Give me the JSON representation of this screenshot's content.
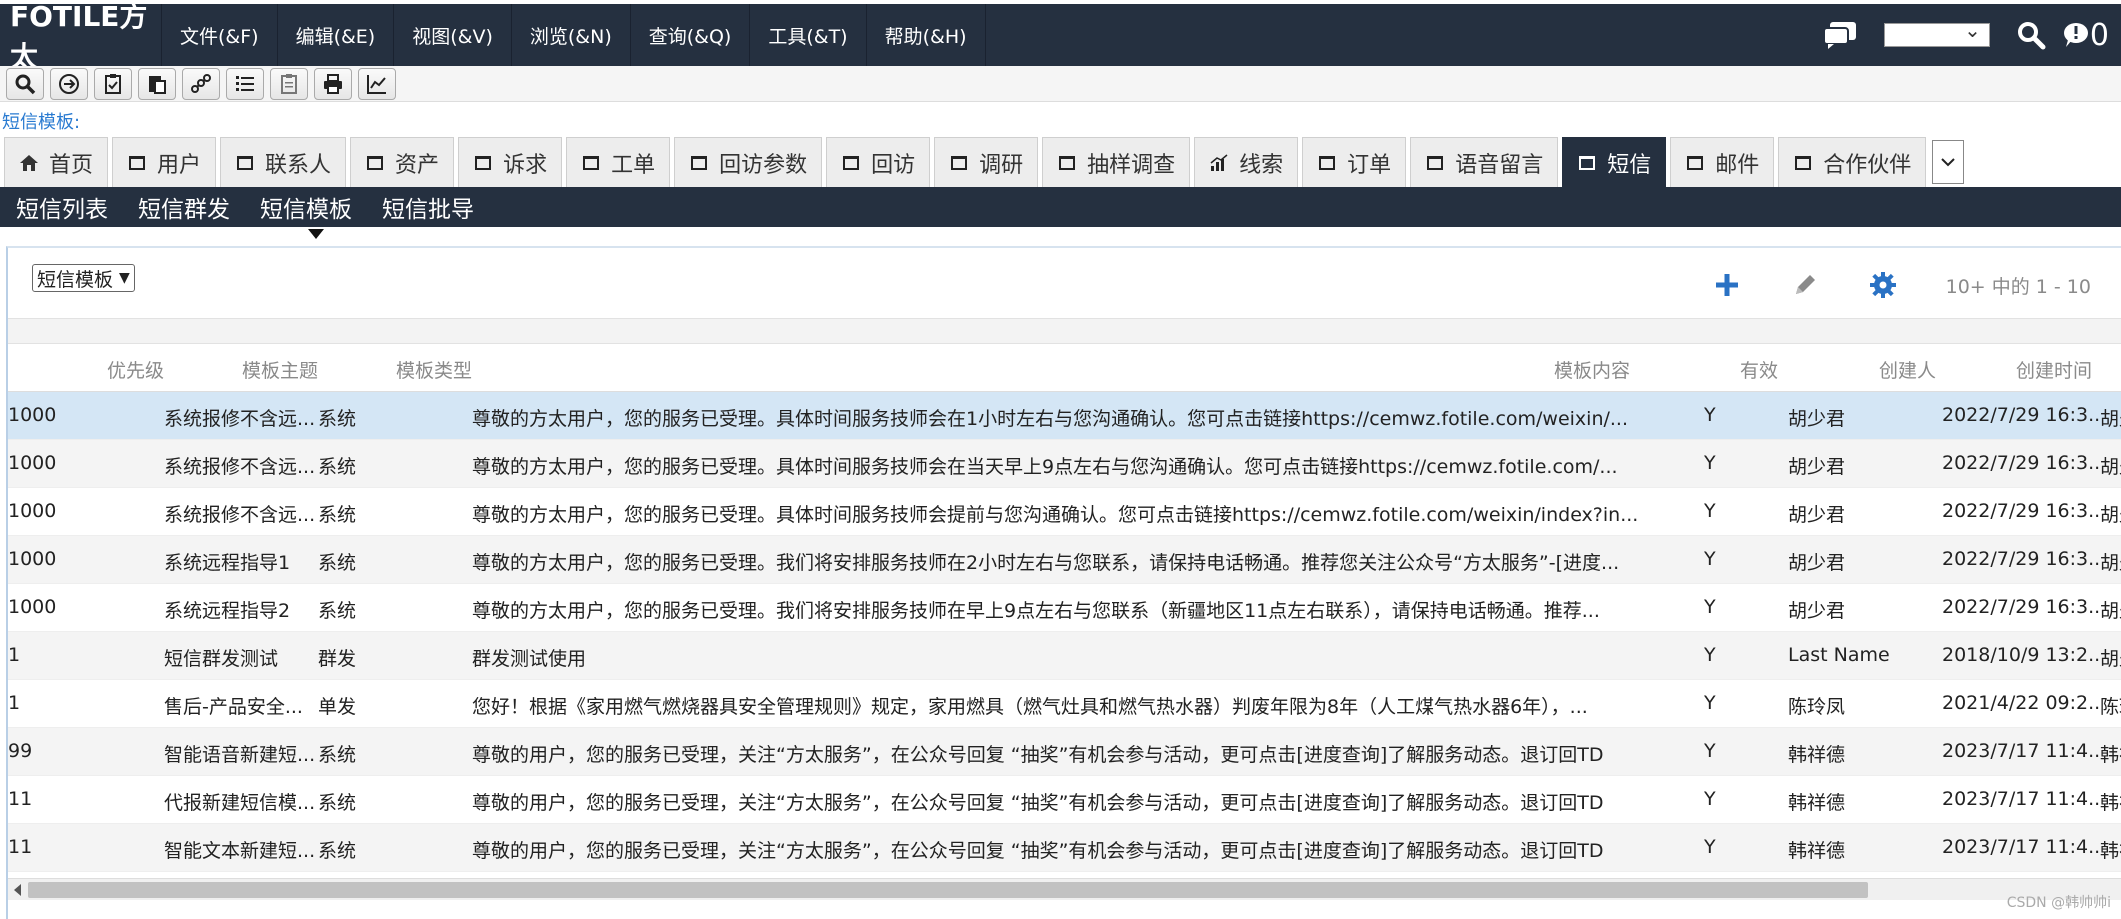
{
  "brand": {
    "logo": "FOTILE方太"
  },
  "menu": [
    "文件(&F)",
    "编辑(&E)",
    "视图(&V)",
    "浏览(&N)",
    "查询(&Q)",
    "工具(&T)",
    "帮助(&H)"
  ],
  "header_right": {
    "notif_count": "0"
  },
  "breadcrumb": "短信模板:",
  "tabs": [
    "首页",
    "用户",
    "联系人",
    "资产",
    "诉求",
    "工单",
    "回访参数",
    "回访",
    "调研",
    "抽样调查",
    "线索",
    "订单",
    "语音留言",
    "短信",
    "邮件",
    "合作伙伴"
  ],
  "subnav": [
    "短信列表",
    "短信群发",
    "短信模板",
    "短信批导"
  ],
  "view_select": "短信模板",
  "page_info": "10+ 中的 1 - 10",
  "columns": [
    "优先级",
    "模板主题",
    "模板类型",
    "模板内容",
    "有效",
    "创建人",
    "创建时间"
  ],
  "rows": [
    {
      "priority": "1000",
      "subject": "系统报修不含远...",
      "type": "系统",
      "content": "尊敬的方太用户，您的服务已受理。具体时间服务技师会在1小时左右与您沟通确认。您可点击链接https://cemwz.fotile.com/weixin/...",
      "valid": "Y",
      "creator": "胡少君",
      "created": "2022/7/29 16:3...",
      "extra": "胡少"
    },
    {
      "priority": "1000",
      "subject": "系统报修不含远...",
      "type": "系统",
      "content": "尊敬的方太用户，您的服务已受理。具体时间服务技师会在当天早上9点左右与您沟通确认。您可点击链接https://cemwz.fotile.com/...",
      "valid": "Y",
      "creator": "胡少君",
      "created": "2022/7/29 16:3...",
      "extra": "胡少"
    },
    {
      "priority": "1000",
      "subject": "系统报修不含远...",
      "type": "系统",
      "content": "尊敬的方太用户，您的服务已受理。具体时间服务技师会提前与您沟通确认。您可点击链接https://cemwz.fotile.com/weixin/index?in...",
      "valid": "Y",
      "creator": "胡少君",
      "created": "2022/7/29 16:3...",
      "extra": "胡少"
    },
    {
      "priority": "1000",
      "subject": "系统远程指导1",
      "type": "系统",
      "content": "尊敬的方太用户，您的服务已受理。我们将安排服务技师在2小时左右与您联系，请保持电话畅通。推荐您关注公众号“方太服务”-[进度...",
      "valid": "Y",
      "creator": "胡少君",
      "created": "2022/7/29 16:3...",
      "extra": "胡少"
    },
    {
      "priority": "1000",
      "subject": "系统远程指导2",
      "type": "系统",
      "content": "尊敬的方太用户，您的服务已受理。我们将安排服务技师在早上9点左右与您联系（新疆地区11点左右联系），请保持电话畅通。推荐...",
      "valid": "Y",
      "creator": "胡少君",
      "created": "2022/7/29 16:3...",
      "extra": "胡少"
    },
    {
      "priority": "1",
      "subject": "短信群发测试",
      "type": "群发",
      "content": "群发测试使用",
      "valid": "Y",
      "creator": "Last Name",
      "created": "2018/10/9 13:2...",
      "extra": "胡少"
    },
    {
      "priority": "1",
      "subject": "售后-产品安全...",
      "type": "单发",
      "content": "您好！根据《家用燃气燃烧器具安全管理规则》规定，家用燃具（燃气灶具和燃气热水器）判废年限为8年（人工煤气热水器6年），...",
      "valid": "Y",
      "creator": "陈玲凤",
      "created": "2021/4/22 09:2...",
      "extra": "陈玲"
    },
    {
      "priority": "99",
      "subject": "智能语音新建短...",
      "type": "系统",
      "content": "尊敬的用户，您的服务已受理，关注“方太服务”，在公众号回复 “抽奖”有机会参与活动，更可点击[进度查询]了解服务动态。退订回TD",
      "valid": "Y",
      "creator": "韩祥德",
      "created": "2023/7/17 11:4...",
      "extra": "韩祥"
    },
    {
      "priority": "11",
      "subject": "代报新建短信模...",
      "type": "系统",
      "content": "尊敬的用户，您的服务已受理，关注“方太服务”，在公众号回复 “抽奖”有机会参与活动，更可点击[进度查询]了解服务动态。退订回TD",
      "valid": "Y",
      "creator": "韩祥德",
      "created": "2023/7/17 11:4...",
      "extra": "韩祥"
    },
    {
      "priority": "11",
      "subject": "智能文本新建短...",
      "type": "系统",
      "content": "尊敬的用户，您的服务已受理，关注“方太服务”，在公众号回复 “抽奖”有机会参与活动，更可点击[进度查询]了解服务动态。退订回TD",
      "valid": "Y",
      "creator": "韩祥德",
      "created": "2023/7/17 11:4...",
      "extra": "韩祥"
    }
  ],
  "watermark": "CSDN @韩帅帅i",
  "colors": {
    "nav_dark": "#253040",
    "link_blue": "#2a7bd1",
    "selected_row": "#d4e6f5"
  }
}
